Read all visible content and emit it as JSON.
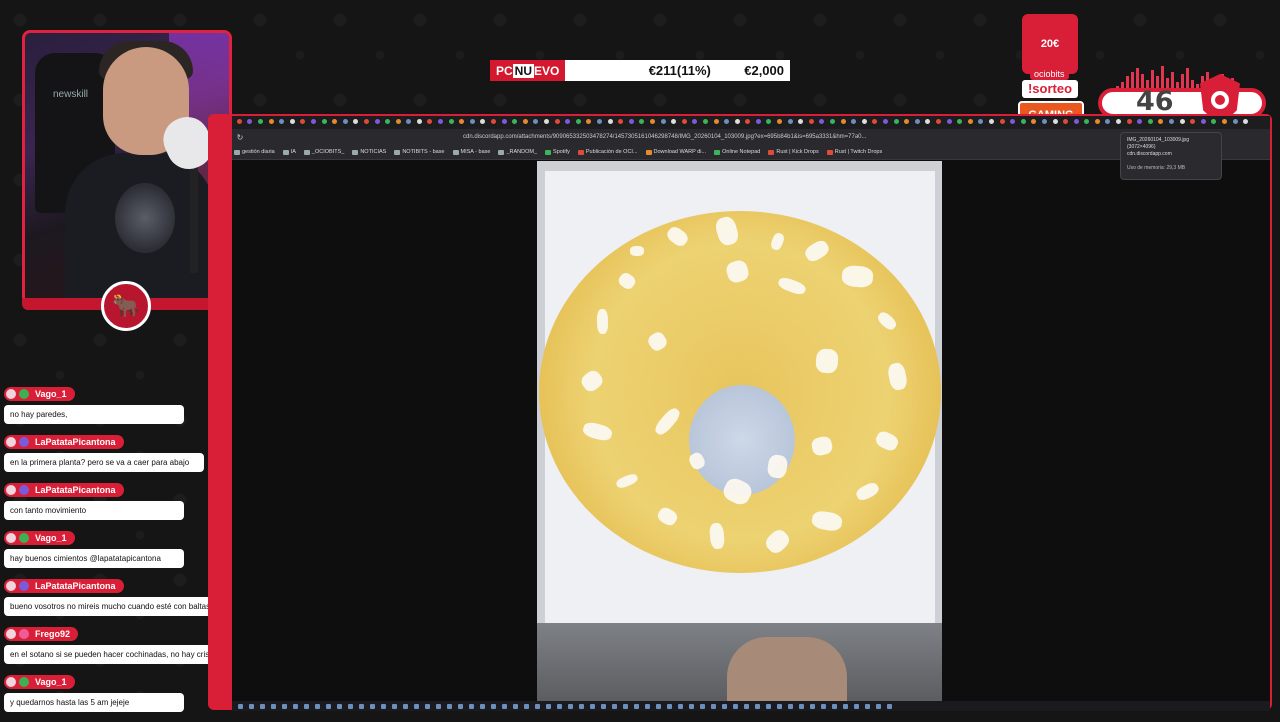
{
  "price_bar": {
    "brand_a": "PC",
    "brand_b": "NU",
    "brand_c": "EVO",
    "discount": "€211(11%)",
    "price": "€2,000"
  },
  "overlay": {
    "sorteo_prize": "20€",
    "sponsor": "ociobits",
    "sorteo_command": "!sorteo",
    "gaming_label": "GAMING",
    "viewer_count": "46"
  },
  "chat": [
    {
      "user": "Vago_1",
      "text": "no hay paredes,"
    },
    {
      "user": "LaPatataPicantona",
      "text": "en la primera planta? pero se va a caer para abajo"
    },
    {
      "user": "LaPatataPicantona",
      "text": "con tanto movimiento"
    },
    {
      "user": "Vago_1",
      "text": "hay buenos cimientos @lapatatapicantona"
    },
    {
      "user": "LaPatataPicantona",
      "text": "bueno vosotros no mireis mucho cuando esté con baltasar"
    },
    {
      "user": "Frego92",
      "text": "en el sotano si se pueden hacer cochinadas, no hay cristal"
    },
    {
      "user": "Vago_1",
      "text": "y quedarnos hasta las 5 am jejeje"
    }
  ],
  "browser": {
    "url": "cdn.discordapp.com/attachments/909065332503478274/1457305161046298748/IMG_20260104_103009.jpg?ex=695b84b1&is=695a3331&hm=77a0...",
    "bookmarks": [
      "gestión diaria",
      "IA",
      "_OCIOBITS_",
      "NOTICIAS",
      "NOTIBITS - base",
      "MISA - base",
      "_RANDOM_",
      "Spotify",
      "Publicación de OCI...",
      "Download WARP di...",
      "Online Notepad",
      "Rust | Kick Drops",
      "Rust | Twitch Drops"
    ],
    "tooltip": {
      "title": "IMG_20260104_103009.jpg",
      "dims": "(3072×4096)",
      "domain": "cdn.discordapp.com",
      "memory": "Uso de memoria: 29,3 MB"
    },
    "webcam_chair_text": "newskill"
  },
  "colors": {
    "accent": "#d81f37",
    "background": "#151515"
  }
}
